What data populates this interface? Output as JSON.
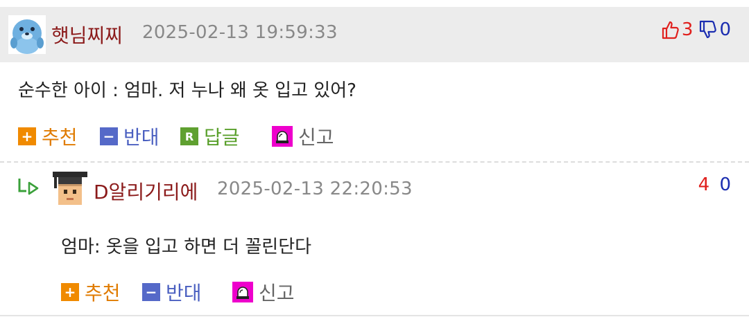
{
  "comments": [
    {
      "author": "햇님찌찌",
      "date": "2025-02-13 19:59:33",
      "upvotes": "3",
      "downvotes": "0",
      "text": "순수한 아이 : 엄마. 저 누나 왜 옷 입고 있어?",
      "actions": {
        "recommend": "추천",
        "oppose": "반대",
        "reply": "답글",
        "report": "신고"
      }
    },
    {
      "author": "D알리기리에",
      "date": "2025-02-13 22:20:53",
      "upvotes": "4",
      "downvotes": "0",
      "text": "엄마: 옷을 입고 하면 더 꼴린단다",
      "actions": {
        "recommend": "추천",
        "oppose": "반대",
        "report": "신고"
      }
    }
  ],
  "icons": {
    "comment1_avatar": "blue-seal-avatar-icon",
    "comment2_avatar": "graduate-pixel-avatar-icon",
    "thumbs_up": "thumbs-up-icon",
    "thumbs_down": "thumbs-down-icon",
    "reply_arrow": "reply-arrow-icon",
    "report": "siren-icon"
  },
  "colors": {
    "author": "#8b1a1a",
    "recommend": "#f08a00",
    "oppose": "#5569c8",
    "reply": "#5fa030",
    "report_bg": "#ee00cc",
    "upvote": "#e0201d",
    "downvote": "#1b2db0",
    "header_bg": "#ececec"
  }
}
